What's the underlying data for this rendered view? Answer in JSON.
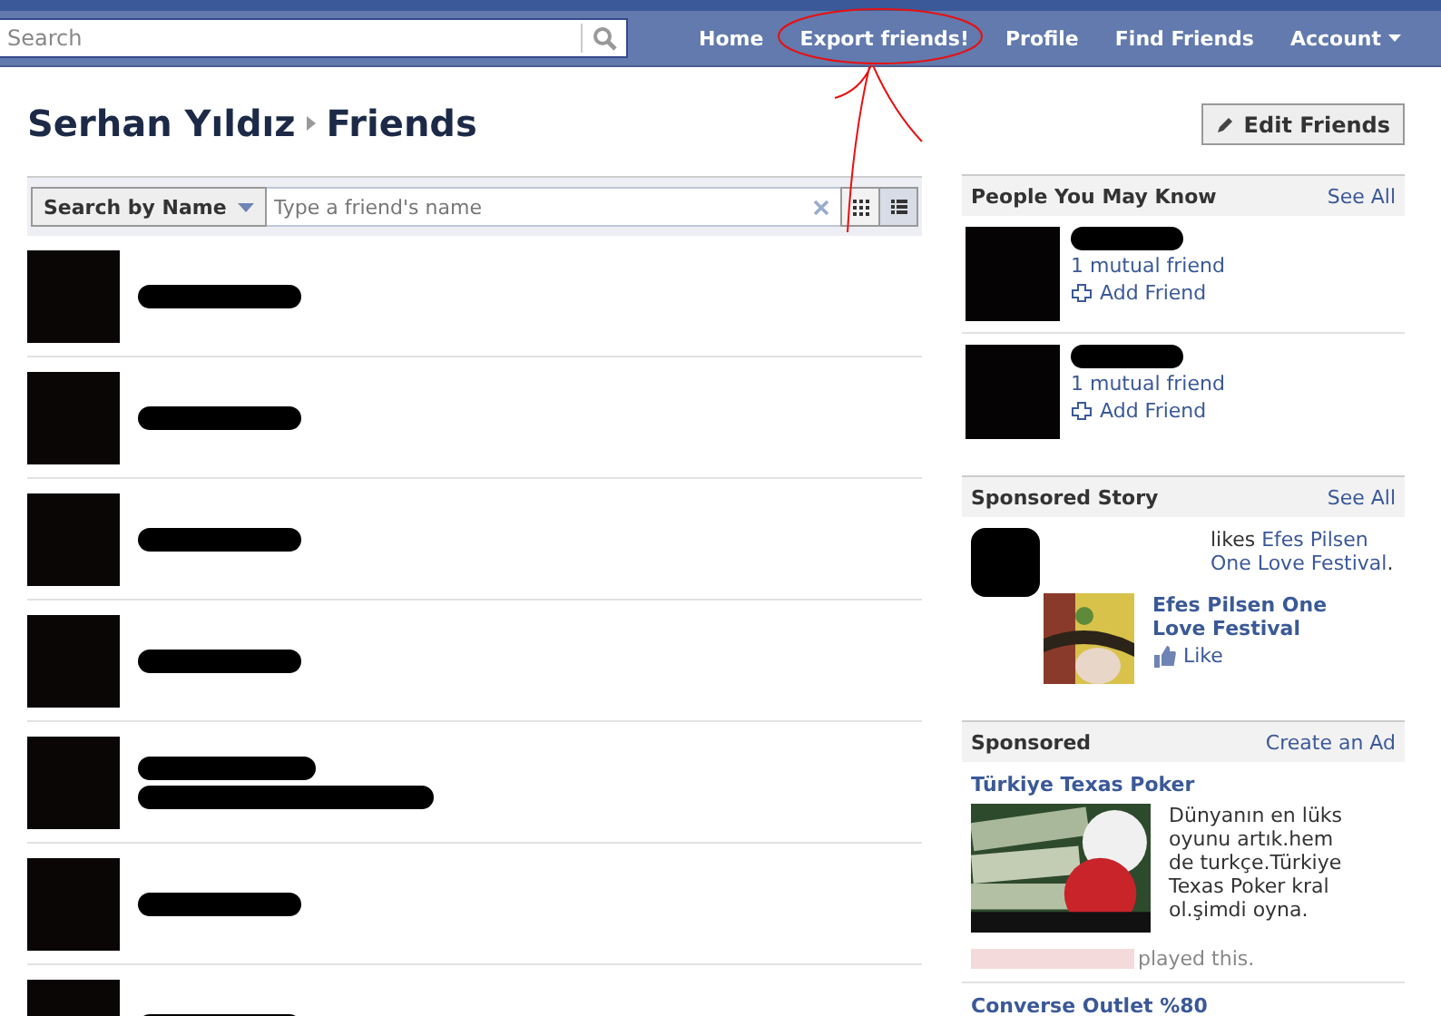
{
  "search": {
    "placeholder": "Search"
  },
  "nav": [
    {
      "label": "Home",
      "dropdown": false
    },
    {
      "label": "Export friends!",
      "dropdown": false
    },
    {
      "label": "Profile",
      "dropdown": false
    },
    {
      "label": "Find Friends",
      "dropdown": false
    },
    {
      "label": "Account",
      "dropdown": true
    }
  ],
  "breadcrumb": [
    "Serhan Yıldız",
    "Friends"
  ],
  "edit_button": "Edit Friends",
  "filter": {
    "mode": "Search by Name",
    "placeholder": "Type a friend's name"
  },
  "view_toggle": [
    {
      "kind": "grid",
      "selected": false
    },
    {
      "kind": "list",
      "selected": true
    }
  ],
  "friends": [
    {
      "kind": "single"
    },
    {
      "kind": "single"
    },
    {
      "kind": "single"
    },
    {
      "kind": "single"
    },
    {
      "kind": "double"
    },
    {
      "kind": "single"
    },
    {
      "kind": "single"
    }
  ],
  "people_you_may_know": {
    "title": "People You May Know",
    "see_all": "See All",
    "people": [
      {
        "mutual": "1 mutual friend",
        "action": "Add Friend"
      },
      {
        "mutual": "1 mutual friend",
        "action": "Add Friend"
      }
    ]
  },
  "sponsored_story": {
    "title": "Sponsored Story",
    "see_all": "See All",
    "verb": "likes",
    "link": "Efes Pilsen One Love Festival",
    "end": ".",
    "page_title": "Efes Pilsen One Love Festival",
    "like": "Like"
  },
  "sponsored": {
    "title": "Sponsored",
    "create_ad": "Create an Ad",
    "ads": [
      {
        "title": "Türkiye Texas Poker",
        "body": "Dünyanın en lüks oyunu artık.hem de turkçe.Türkiye Texas Poker kral ol.şimdi oyna.",
        "social": "played this."
      },
      {
        "title": "Converse Outlet %80"
      }
    ]
  }
}
